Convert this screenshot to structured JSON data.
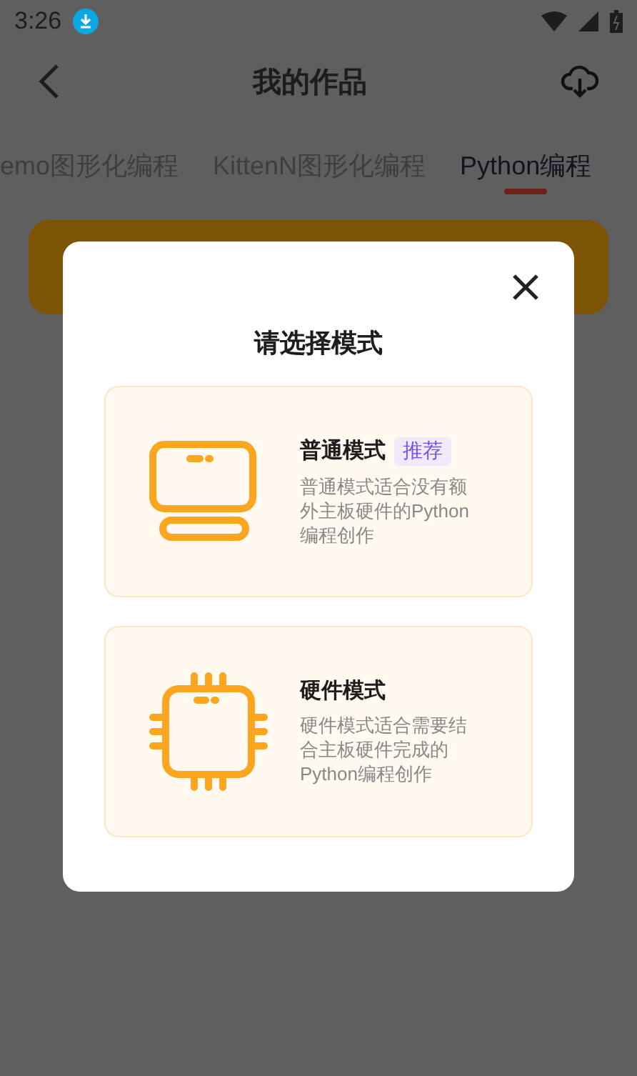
{
  "status_bar": {
    "time": "3:26"
  },
  "header": {
    "title": "我的作品"
  },
  "tabs": [
    {
      "label": "emo图形化编程",
      "selected": false
    },
    {
      "label": "KittenN图形化编程",
      "selected": false
    },
    {
      "label": "Python编程",
      "selected": true
    }
  ],
  "dialog": {
    "title": "请选择模式",
    "modes": [
      {
        "kind": "monitor",
        "name": "普通模式",
        "badge": "推荐",
        "description": "普通模式适合没有额外主板硬件的Python编程创作"
      },
      {
        "kind": "chip",
        "name": "硬件模式",
        "description": "硬件模式适合需要结合主板硬件完成的Python编程创作"
      }
    ]
  }
}
